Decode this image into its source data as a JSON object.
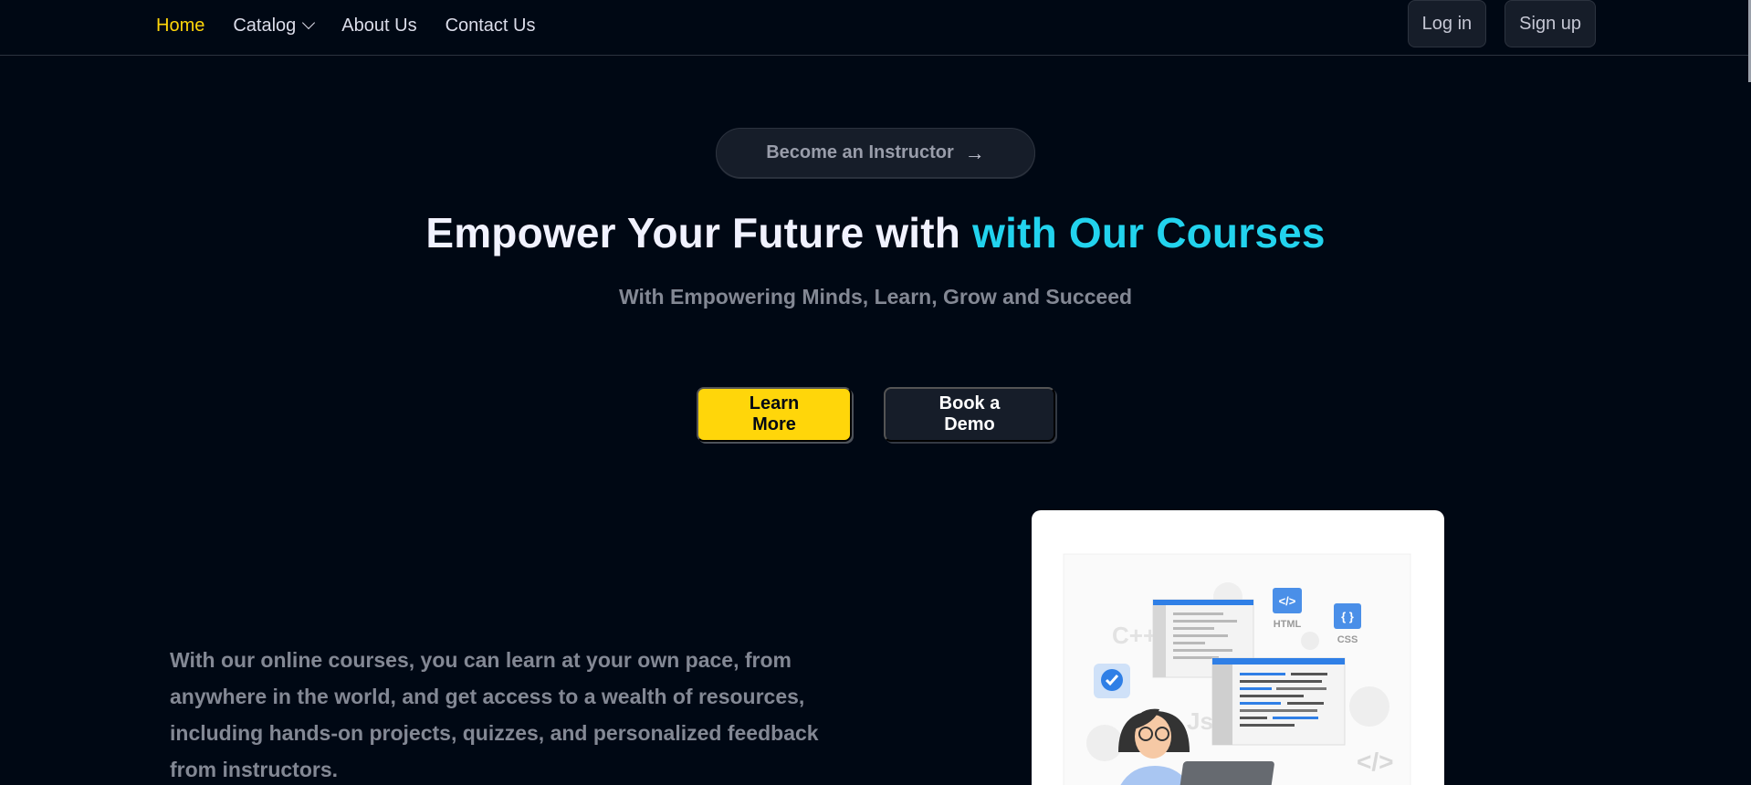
{
  "nav": {
    "links": [
      {
        "label": "Home",
        "active": true
      },
      {
        "label": "Catalog",
        "active": false
      },
      {
        "label": "About Us",
        "active": false
      },
      {
        "label": "Contact Us",
        "active": false
      }
    ],
    "login_label": "Log in",
    "signup_label": "Sign up"
  },
  "hero": {
    "instructor_label": "Become an Instructor",
    "instructor_icon": "arrow-right-icon",
    "title_main": "Empower Your Future with ",
    "title_accent": "with Our Courses",
    "subtitle": "With Empowering Minds, Learn, Grow and Succeed",
    "learn_more_label": "Learn More",
    "book_demo_label": "Book a Demo"
  },
  "content": {
    "description": "With our online courses, you can learn at your own pace, from anywhere in the world, and get access to a wealth of resources, including hands-on projects, quizzes, and personalized feedback from instructors."
  },
  "illustration": {
    "labels": {
      "cpp": "C++",
      "html": "HTML",
      "html_glyph": "</>",
      "css": "CSS",
      "css_glyph": "{ }",
      "code_glyph": "</>",
      "js": "Js"
    }
  },
  "colors": {
    "background": "#000814",
    "accent_yellow": "#FFD60A",
    "accent_cyan": "#22D3EE",
    "muted_text": "#838894",
    "surface": "#161D29"
  }
}
